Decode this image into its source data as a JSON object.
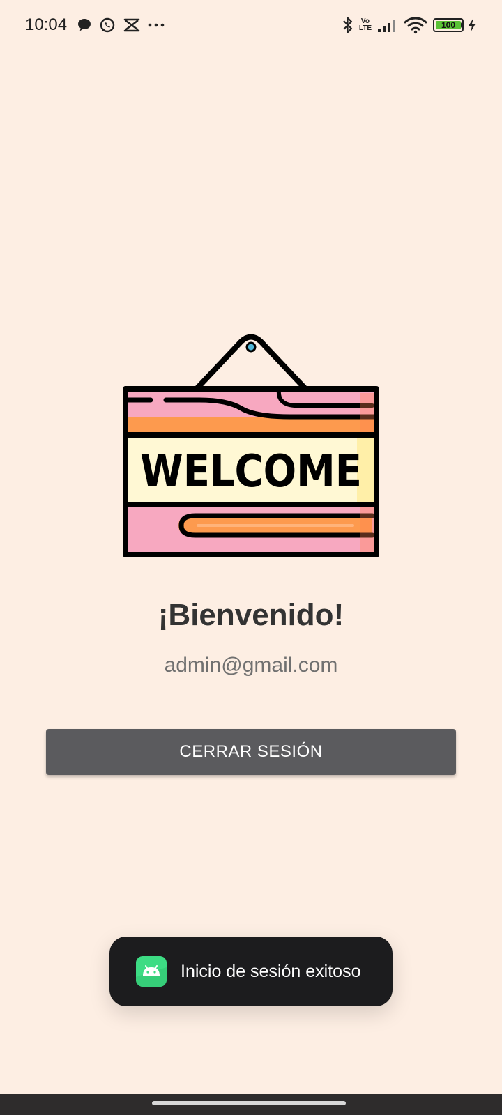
{
  "status_bar": {
    "time": "10:04",
    "left_icons": [
      "chat-bubble-icon",
      "whatsapp-icon",
      "capcut-icon",
      "more-dots-icon"
    ],
    "right_icons": [
      "bluetooth-icon",
      "volte-icon",
      "signal-icon",
      "wifi-icon",
      "battery-icon",
      "charging-icon"
    ],
    "volte_line1": "Vo",
    "volte_line2": "LTE",
    "battery_level": "100",
    "battery_color": "#5BC236"
  },
  "sign": {
    "text": "WELCOME",
    "colors": {
      "pink": "#F7A8C0",
      "orange": "#FD9A4E",
      "cream": "#FFF8D4",
      "outline": "#000000",
      "nail": "#4FB6D8"
    }
  },
  "main": {
    "greeting": "¡Bienvenido!",
    "email": "admin@gmail.com",
    "logout_label": "CERRAR SESIÓN"
  },
  "toast": {
    "app_icon": "android-app-icon",
    "message": "Inicio de sesión exitoso"
  },
  "colors": {
    "background": "#FDEEE3",
    "button": "#5B5B5E",
    "toast": "#1C1C1E"
  }
}
